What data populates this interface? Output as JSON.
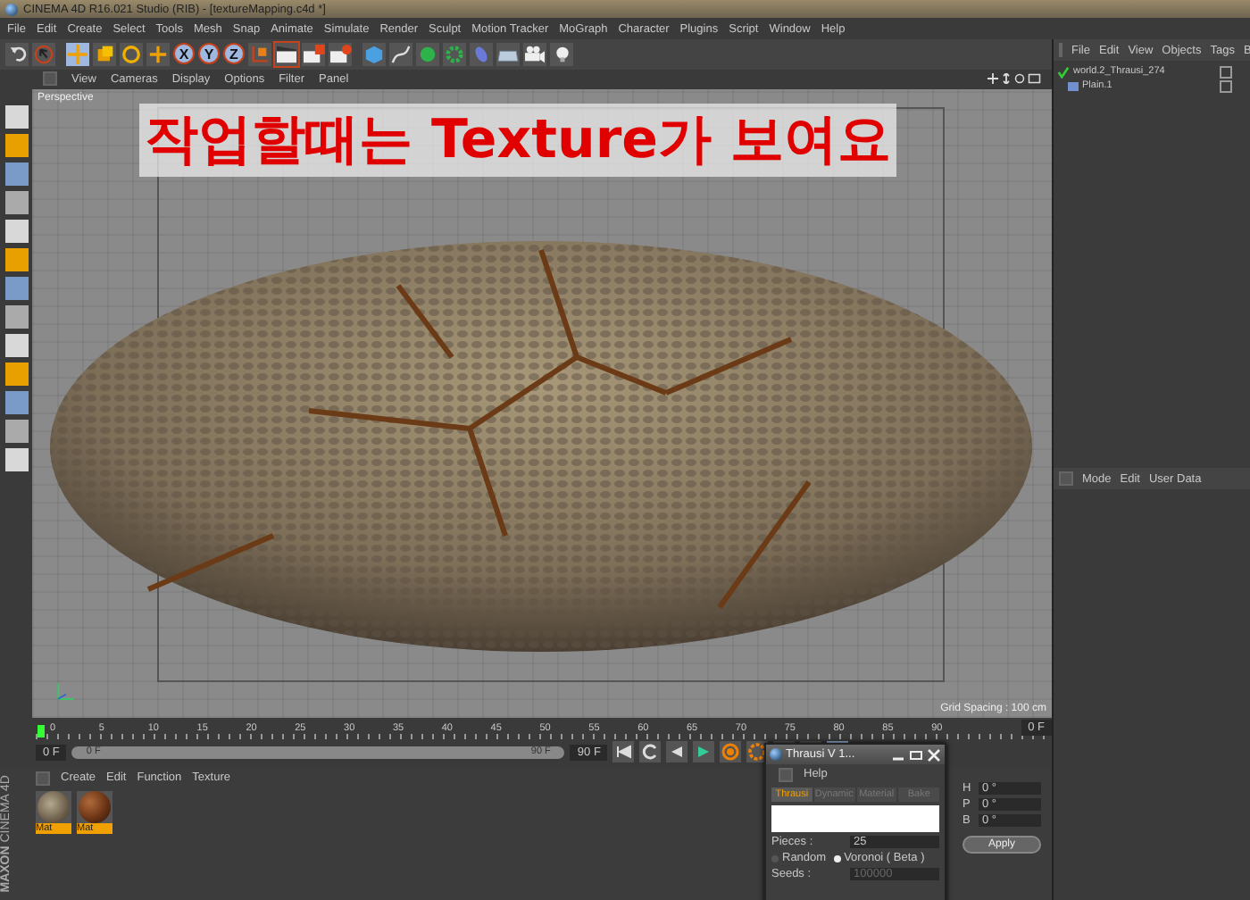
{
  "window": {
    "title": "CINEMA 4D R16.021 Studio (RIB) - [textureMapping.c4d *]"
  },
  "menu": [
    "File",
    "Edit",
    "Create",
    "Select",
    "Tools",
    "Mesh",
    "Snap",
    "Animate",
    "Simulate",
    "Render",
    "Sculpt",
    "Motion Tracker",
    "MoGraph",
    "Character",
    "Plugins",
    "Script",
    "Window",
    "Help"
  ],
  "toolbar": {
    "axis_buttons": [
      "X",
      "Y",
      "Z"
    ]
  },
  "viewport": {
    "menu": [
      "View",
      "Cameras",
      "Display",
      "Options",
      "Filter",
      "Panel"
    ],
    "camera": "Perspective",
    "annotation": "작업할때는 Texture가 보여요",
    "grid_spacing": "Grid Spacing : 100 cm"
  },
  "timeline": {
    "ticks": [
      "0",
      "5",
      "10",
      "15",
      "20",
      "25",
      "30",
      "35",
      "40",
      "45",
      "50",
      "55",
      "60",
      "65",
      "70",
      "75",
      "80",
      "85",
      "90"
    ],
    "current_frame": "0 F",
    "start_field": "0 F",
    "range": {
      "start": "0 F",
      "end": "90 F",
      "level": 1
    },
    "end_field": "90 F"
  },
  "materials": {
    "menu": [
      "Create",
      "Edit",
      "Function",
      "Texture"
    ],
    "items": [
      {
        "name": "Mat",
        "kind": "stone"
      },
      {
        "name": "Mat",
        "kind": "wood"
      }
    ]
  },
  "logo": {
    "brand": "MAXON",
    "product": "CINEMA 4D"
  },
  "object_manager": {
    "menu": [
      "File",
      "Edit",
      "View",
      "Objects",
      "Tags",
      "B"
    ],
    "objects": [
      {
        "name": "world.2_Thrausi_274",
        "children": [
          {
            "name": "Plain.1"
          }
        ]
      }
    ]
  },
  "attributes": {
    "menu": [
      "Mode",
      "Edit",
      "User Data"
    ]
  },
  "coordinates": {
    "rows": [
      {
        "label": "H",
        "value": "0 °"
      },
      {
        "label": "P",
        "value": "0 °"
      },
      {
        "label": "B",
        "value": "0 °"
      }
    ],
    "apply": "Apply"
  },
  "dialog": {
    "title": "Thrausi V 1...",
    "menu": [
      "Help"
    ],
    "tabs": [
      {
        "label": "Thrausi",
        "selected": true
      },
      {
        "label": "Dynamic",
        "selected": false
      },
      {
        "label": "Material",
        "selected": false
      },
      {
        "label": "Bake",
        "selected": false
      }
    ],
    "pieces_label": "Pieces :",
    "pieces": "25",
    "modes": [
      {
        "label": "Random",
        "selected": false
      },
      {
        "label": "Voronoi ( Beta )",
        "selected": true
      }
    ],
    "seeds_label": "Seeds :",
    "seeds": "100000"
  }
}
